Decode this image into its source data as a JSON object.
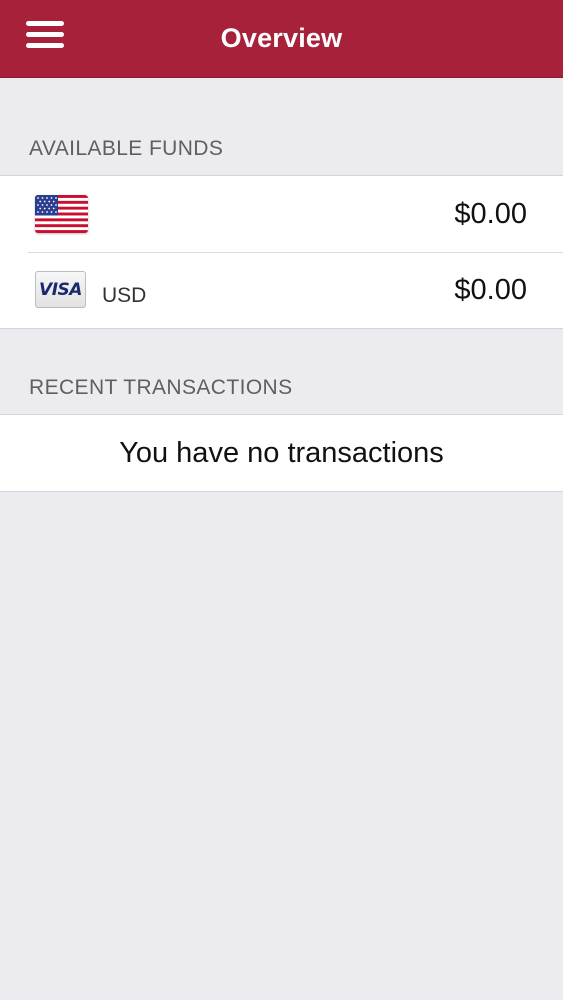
{
  "navbar": {
    "title": "Overview",
    "menu_icon": "hamburger-menu-icon",
    "background_color": "#a8213a"
  },
  "available_funds": {
    "header": "AVAILABLE FUNDS",
    "rows": [
      {
        "icon": "us-flag-icon",
        "currency": "",
        "amount": "$0.00"
      },
      {
        "icon": "visa-card-icon",
        "icon_text": "VISA",
        "currency": "USD",
        "amount": "$0.00"
      }
    ]
  },
  "recent_transactions": {
    "header": "RECENT TRANSACTIONS",
    "empty_message": "You have no transactions"
  }
}
